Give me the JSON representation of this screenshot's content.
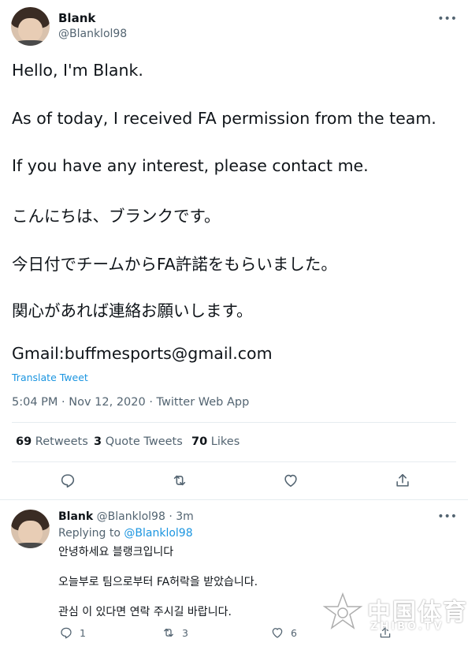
{
  "tweet": {
    "name": "Blank",
    "handle": "@Blanklol98",
    "more": "•••",
    "lines": [
      "Hello, I'm Blank.",
      "As of today, I received FA permission from the team.",
      "If you have any interest, please contact me.",
      "こんにちは、ブランクです。",
      "今日付でチームからFA許諾をもらいました。",
      "関心があれば連絡お願いします。",
      "Gmail:buffmesports@gmail.com"
    ],
    "translate": "Translate Tweet",
    "meta": "5:04 PM · Nov 12, 2020 · Twitter Web App",
    "stats": {
      "retweets_count": "69",
      "retweets_label": "Retweets",
      "quotes_count": "3",
      "quotes_label": "Quote Tweets",
      "likes_count": "70",
      "likes_label": "Likes"
    },
    "icons": [
      "reply-icon",
      "retweet-icon",
      "like-icon",
      "share-icon"
    ]
  },
  "reply": {
    "name": "Blank",
    "handle_time": "@Blanklol98 · 3m",
    "more": "•••",
    "replying_prefix": "Replying to",
    "replying_mention": "@Blanklol98",
    "lines": [
      "안녕하세요 블랭크입니다",
      "오늘부로 팀으로부터 FA허락을 받았습니다.",
      "관심 이 있다면 연락 주시길 바랍니다."
    ],
    "reply_count": "1",
    "retweet_count": "3",
    "like_count": "6"
  },
  "watermark": {
    "text": "中国体育",
    "sub": "ZHIBO.TV"
  },
  "colors": {
    "text": "#0f1419",
    "secondary": "#536471",
    "link": "#1b95e0",
    "border": "#e6ecf0"
  }
}
